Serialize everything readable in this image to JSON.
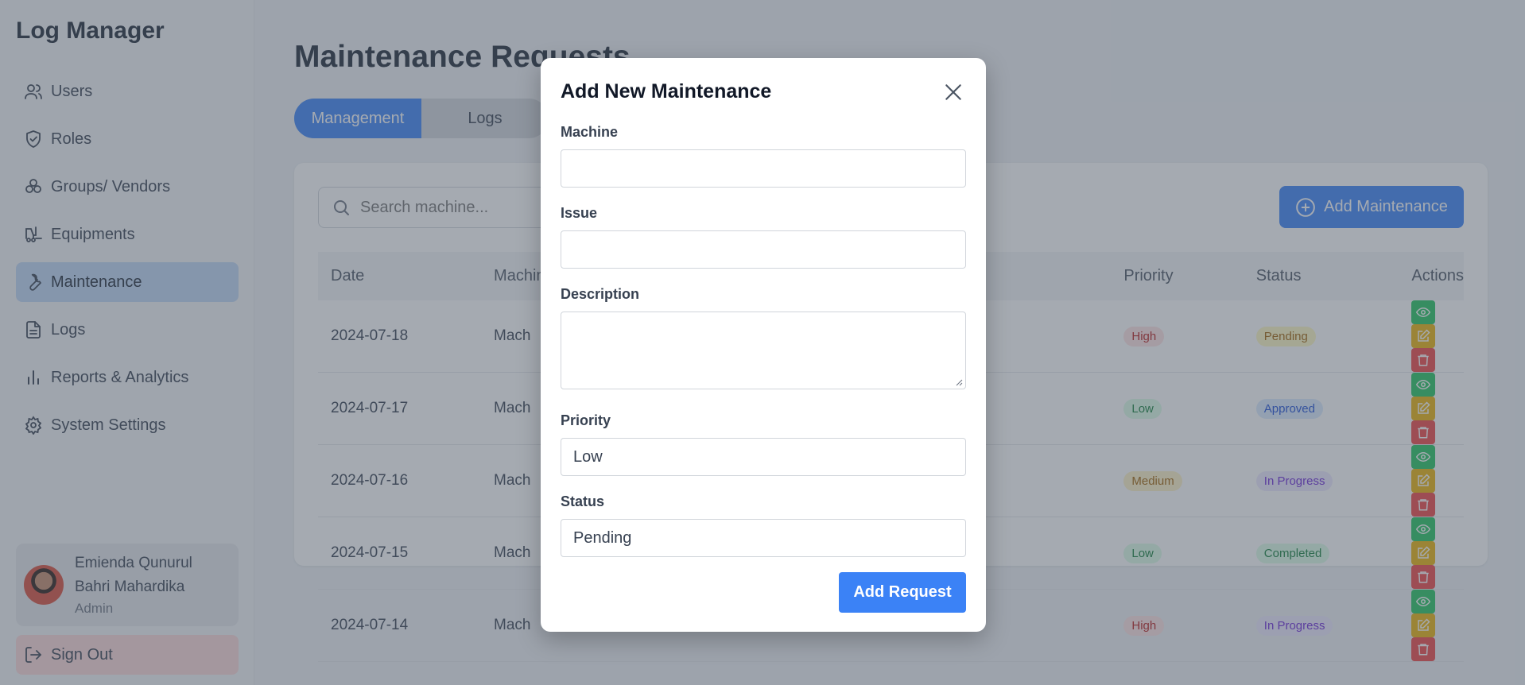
{
  "sidebar": {
    "brand": "Log Manager",
    "items": [
      {
        "label": "Users",
        "icon": "users-icon"
      },
      {
        "label": "Roles",
        "icon": "shield-icon"
      },
      {
        "label": "Groups/ Vendors",
        "icon": "groups-icon"
      },
      {
        "label": "Equipments",
        "icon": "forklift-icon"
      },
      {
        "label": "Maintenance",
        "icon": "wrench-icon",
        "active": true
      },
      {
        "label": "Logs",
        "icon": "document-icon"
      },
      {
        "label": "Reports & Analytics",
        "icon": "bar-chart-icon"
      },
      {
        "label": "System Settings",
        "icon": "gear-icon"
      }
    ],
    "profile": {
      "name_line1": "Emienda Qunurul",
      "name_line2": "Bahri Mahardika",
      "role": "Admin"
    },
    "sign_out": "Sign Out"
  },
  "main": {
    "title": "Maintenance Requests",
    "tabs": [
      "Management",
      "Logs"
    ],
    "search_placeholder": "Search machine...",
    "add_button": "Add Maintenance",
    "table": {
      "headers": [
        "Date",
        "Machine",
        "Priority",
        "Status",
        "Actions"
      ],
      "rows": [
        {
          "date": "2024-07-18",
          "machine": "Mach",
          "priority": "High",
          "status": "Pending"
        },
        {
          "date": "2024-07-17",
          "machine": "Mach",
          "priority": "Low",
          "status": "Approved"
        },
        {
          "date": "2024-07-16",
          "machine": "Mach",
          "priority": "Medium",
          "status": "In Progress"
        },
        {
          "date": "2024-07-15",
          "machine": "Mach",
          "priority": "Low",
          "status": "Completed"
        },
        {
          "date": "2024-07-14",
          "machine": "Mach",
          "priority": "High",
          "status": "In Progress"
        }
      ]
    }
  },
  "modal": {
    "title": "Add New Maintenance",
    "fields": {
      "machine_label": "Machine",
      "machine_value": "",
      "issue_label": "Issue",
      "issue_value": "",
      "description_label": "Description",
      "description_value": "",
      "priority_label": "Priority",
      "priority_value": "Low",
      "status_label": "Status",
      "status_value": "Pending"
    },
    "submit": "Add Request"
  },
  "colors": {
    "accent": "#3b82f6",
    "view": "#22c55e",
    "edit": "#eab308",
    "delete": "#ef4444"
  }
}
